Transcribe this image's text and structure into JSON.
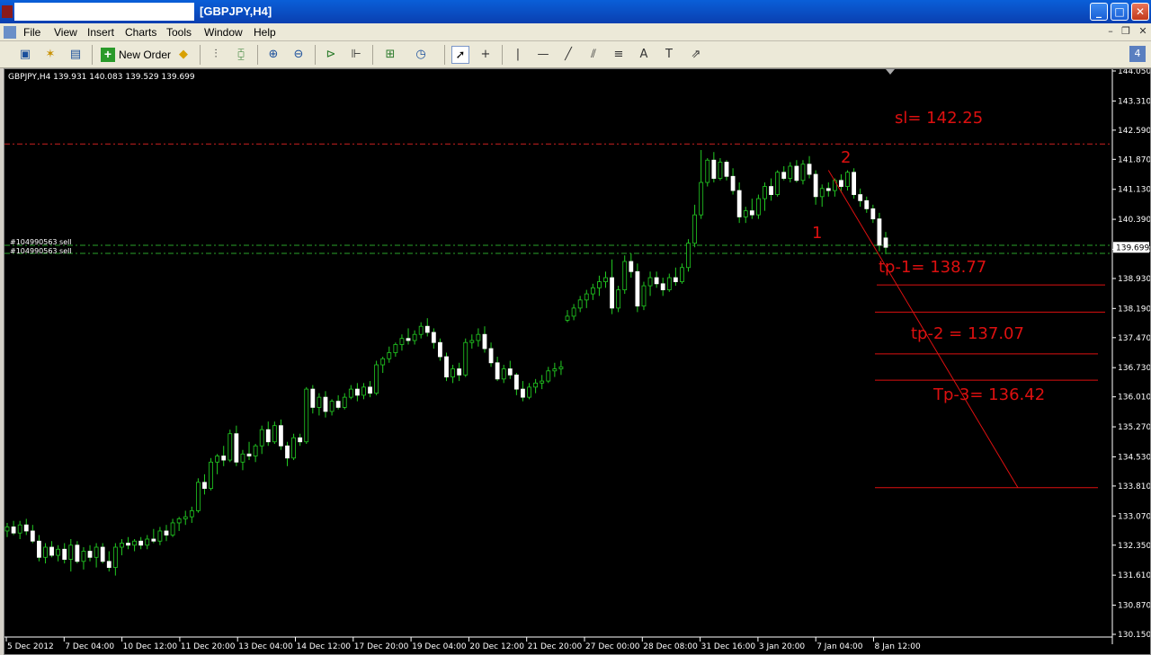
{
  "window": {
    "title": "[GBPJPY,H4]"
  },
  "menu": [
    "File",
    "View",
    "Insert",
    "Charts",
    "Tools",
    "Window",
    "Help"
  ],
  "toolbar": {
    "new_order_label": "New Order",
    "badge": "4"
  },
  "chart_data": {
    "type": "candlestick",
    "symbol_header": "GBPJPY,H4  139.931 140.083 139.529 139.699",
    "current_price": "139.699",
    "price_ticks": [
      "144.050",
      "143.310",
      "142.590",
      "141.870",
      "141.130",
      "140.390",
      "139.650",
      "138.930",
      "138.190",
      "137.470",
      "136.730",
      "136.010",
      "135.270",
      "134.530",
      "133.810",
      "133.070",
      "132.350",
      "131.610",
      "130.870",
      "130.150"
    ],
    "time_ticks": [
      "5 Dec 2012",
      "7 Dec 04:00",
      "10 Dec 12:00",
      "11 Dec 20:00",
      "13 Dec 04:00",
      "14 Dec 12:00",
      "17 Dec 20:00",
      "19 Dec 04:00",
      "20 Dec 12:00",
      "21 Dec 20:00",
      "27 Dec 00:00",
      "28 Dec 08:00",
      "31 Dec 16:00",
      "3 Jan 20:00",
      "7 Jan 04:00",
      "8 Jan 12:00"
    ],
    "ylim": [
      130.15,
      144.05
    ],
    "order_labels": [
      "#104990563 sell",
      "#104990563 sell"
    ],
    "annotations": {
      "sl": "sl= 142.25",
      "tp1": "tp-1= 138.77",
      "tp2": "tp-2 = 137.07",
      "tp3": "Tp-3= 136.42",
      "wave1": "1",
      "wave2": "2"
    },
    "levels": {
      "sl": 142.25,
      "order_entry_1": 139.75,
      "order_entry_2": 139.55,
      "tp1_line": 138.77,
      "tp1b_line": 138.1,
      "tp2_line": 137.07,
      "tp2b_line": 136.42,
      "tp3_line": 133.77
    },
    "trend_line": {
      "from_price": 141.6,
      "to_price": 133.77
    },
    "candles": [
      [
        132.7,
        132.9,
        132.55,
        132.8
      ],
      [
        132.8,
        132.95,
        132.6,
        132.65
      ],
      [
        132.65,
        132.95,
        132.5,
        132.85
      ],
      [
        132.85,
        133.0,
        132.6,
        132.7
      ],
      [
        132.7,
        132.85,
        132.4,
        132.45
      ],
      [
        132.45,
        132.6,
        131.95,
        132.05
      ],
      [
        132.05,
        132.4,
        131.9,
        132.3
      ],
      [
        132.3,
        132.45,
        132.05,
        132.1
      ],
      [
        132.1,
        132.35,
        131.95,
        132.25
      ],
      [
        132.25,
        132.4,
        131.9,
        132.0
      ],
      [
        132.0,
        132.5,
        131.7,
        132.35
      ],
      [
        132.35,
        132.45,
        131.9,
        131.95
      ],
      [
        131.95,
        132.3,
        131.75,
        132.2
      ],
      [
        132.2,
        132.35,
        131.95,
        132.05
      ],
      [
        132.05,
        132.4,
        131.8,
        132.3
      ],
      [
        132.3,
        132.4,
        131.9,
        131.95
      ],
      [
        131.95,
        132.2,
        131.7,
        131.8
      ],
      [
        131.8,
        132.4,
        131.6,
        132.3
      ],
      [
        132.3,
        132.5,
        132.1,
        132.4
      ],
      [
        132.4,
        132.55,
        132.25,
        132.35
      ],
      [
        132.35,
        132.5,
        132.2,
        132.45
      ],
      [
        132.45,
        132.55,
        132.25,
        132.35
      ],
      [
        132.35,
        132.6,
        132.25,
        132.5
      ],
      [
        132.5,
        132.75,
        132.4,
        132.45
      ],
      [
        132.45,
        132.8,
        132.35,
        132.7
      ],
      [
        132.7,
        132.85,
        132.45,
        132.6
      ],
      [
        132.6,
        133.0,
        132.55,
        132.9
      ],
      [
        132.9,
        133.05,
        132.7,
        133.0
      ],
      [
        133.0,
        133.2,
        132.85,
        133.05
      ],
      [
        133.05,
        133.3,
        132.9,
        133.2
      ],
      [
        133.2,
        134.0,
        133.15,
        133.9
      ],
      [
        133.9,
        134.1,
        133.6,
        133.75
      ],
      [
        133.75,
        134.5,
        133.7,
        134.4
      ],
      [
        134.4,
        134.6,
        134.1,
        134.55
      ],
      [
        134.55,
        134.8,
        134.3,
        134.45
      ],
      [
        134.45,
        135.2,
        134.4,
        135.1
      ],
      [
        135.1,
        135.3,
        134.3,
        134.4
      ],
      [
        134.4,
        134.7,
        134.2,
        134.6
      ],
      [
        134.6,
        134.9,
        134.45,
        134.55
      ],
      [
        134.55,
        134.85,
        134.4,
        134.8
      ],
      [
        134.8,
        135.3,
        134.6,
        135.2
      ],
      [
        135.2,
        135.4,
        134.8,
        134.9
      ],
      [
        134.9,
        135.4,
        134.85,
        135.3
      ],
      [
        135.3,
        135.45,
        134.7,
        134.8
      ],
      [
        134.8,
        134.9,
        134.3,
        134.5
      ],
      [
        134.5,
        135.1,
        134.45,
        135.0
      ],
      [
        135.0,
        135.1,
        134.8,
        134.9
      ],
      [
        134.9,
        136.25,
        134.85,
        136.2
      ],
      [
        136.2,
        136.3,
        135.6,
        135.75
      ],
      [
        135.75,
        136.1,
        135.55,
        136.0
      ],
      [
        136.0,
        136.15,
        135.5,
        135.65
      ],
      [
        135.65,
        135.95,
        135.55,
        135.9
      ],
      [
        135.9,
        136.05,
        135.7,
        135.75
      ],
      [
        135.75,
        136.1,
        135.7,
        136.0
      ],
      [
        136.0,
        136.3,
        135.95,
        136.2
      ],
      [
        136.2,
        136.35,
        135.9,
        136.05
      ],
      [
        136.05,
        136.35,
        135.95,
        136.25
      ],
      [
        136.25,
        136.4,
        136.0,
        136.1
      ],
      [
        136.1,
        136.9,
        136.05,
        136.8
      ],
      [
        136.8,
        137.0,
        136.6,
        136.95
      ],
      [
        136.95,
        137.25,
        136.85,
        137.1
      ],
      [
        137.1,
        137.35,
        137.0,
        137.3
      ],
      [
        137.3,
        137.55,
        137.15,
        137.45
      ],
      [
        137.45,
        137.7,
        137.3,
        137.4
      ],
      [
        137.4,
        137.65,
        137.3,
        137.55
      ],
      [
        137.55,
        137.85,
        137.45,
        137.75
      ],
      [
        137.75,
        137.95,
        137.5,
        137.6
      ],
      [
        137.6,
        137.7,
        137.2,
        137.35
      ],
      [
        137.35,
        137.45,
        136.9,
        137.0
      ],
      [
        137.0,
        137.1,
        136.4,
        136.5
      ],
      [
        136.5,
        136.8,
        136.35,
        136.7
      ],
      [
        136.7,
        136.85,
        136.4,
        136.55
      ],
      [
        136.55,
        137.45,
        136.5,
        137.35
      ],
      [
        137.35,
        137.55,
        137.2,
        137.4
      ],
      [
        137.4,
        137.7,
        137.25,
        137.55
      ],
      [
        137.55,
        137.75,
        137.1,
        137.2
      ],
      [
        137.2,
        137.35,
        136.75,
        136.85
      ],
      [
        136.85,
        137.0,
        136.4,
        136.45
      ],
      [
        136.45,
        136.8,
        136.35,
        136.7
      ],
      [
        136.7,
        136.9,
        136.45,
        136.55
      ],
      [
        136.55,
        136.6,
        136.05,
        136.2
      ],
      [
        136.2,
        136.4,
        135.9,
        136.0
      ],
      [
        136.0,
        136.35,
        135.95,
        136.25
      ],
      [
        136.25,
        136.45,
        136.1,
        136.35
      ],
      [
        136.35,
        136.55,
        136.2,
        136.4
      ],
      [
        136.4,
        136.75,
        136.35,
        136.65
      ],
      [
        136.65,
        136.85,
        136.5,
        136.7
      ],
      [
        136.7,
        136.9,
        136.55,
        136.75
      ],
      [
        137.9,
        138.15,
        137.85,
        138.0
      ],
      [
        138.0,
        138.3,
        137.9,
        138.2
      ],
      [
        138.2,
        138.5,
        138.1,
        138.4
      ],
      [
        138.4,
        138.65,
        138.2,
        138.55
      ],
      [
        138.55,
        138.8,
        138.4,
        138.7
      ],
      [
        138.7,
        139.0,
        138.5,
        138.85
      ],
      [
        138.85,
        139.1,
        138.7,
        138.95
      ],
      [
        138.95,
        139.4,
        138.05,
        138.2
      ],
      [
        138.2,
        138.75,
        138.1,
        138.65
      ],
      [
        138.65,
        139.5,
        138.55,
        139.35
      ],
      [
        139.35,
        139.55,
        138.95,
        139.1
      ],
      [
        139.1,
        139.3,
        138.1,
        138.25
      ],
      [
        138.25,
        138.85,
        138.15,
        138.75
      ],
      [
        138.75,
        139.1,
        138.5,
        138.95
      ],
      [
        138.95,
        139.1,
        138.7,
        138.8
      ],
      [
        138.8,
        138.95,
        138.5,
        138.65
      ],
      [
        138.65,
        139.05,
        138.6,
        138.95
      ],
      [
        138.95,
        139.2,
        138.75,
        138.85
      ],
      [
        138.85,
        139.3,
        138.8,
        139.2
      ],
      [
        139.2,
        139.9,
        139.1,
        139.8
      ],
      [
        139.8,
        140.75,
        139.7,
        140.5
      ],
      [
        140.5,
        142.1,
        140.4,
        141.3
      ],
      [
        141.3,
        141.9,
        141.2,
        141.85
      ],
      [
        141.85,
        142.05,
        141.3,
        141.4
      ],
      [
        141.4,
        141.9,
        141.35,
        141.8
      ],
      [
        141.8,
        141.85,
        141.35,
        141.45
      ],
      [
        141.45,
        141.65,
        141.0,
        141.1
      ],
      [
        141.1,
        141.3,
        140.3,
        140.45
      ],
      [
        140.45,
        140.7,
        140.3,
        140.6
      ],
      [
        140.6,
        140.9,
        140.4,
        140.5
      ],
      [
        140.5,
        141.0,
        140.4,
        140.9
      ],
      [
        140.9,
        141.3,
        140.6,
        141.2
      ],
      [
        141.2,
        141.4,
        140.85,
        141.0
      ],
      [
        141.0,
        141.6,
        140.95,
        141.55
      ],
      [
        141.55,
        141.7,
        141.35,
        141.4
      ],
      [
        141.4,
        141.8,
        141.3,
        141.7
      ],
      [
        141.7,
        141.85,
        141.3,
        141.35
      ],
      [
        141.35,
        141.85,
        141.25,
        141.75
      ],
      [
        141.75,
        141.95,
        141.4,
        141.5
      ],
      [
        141.5,
        141.6,
        140.75,
        140.95
      ],
      [
        140.95,
        141.25,
        140.7,
        141.15
      ],
      [
        141.15,
        141.3,
        140.95,
        141.1
      ],
      [
        141.1,
        141.4,
        140.95,
        141.35
      ],
      [
        141.35,
        141.5,
        141.05,
        141.2
      ],
      [
        141.2,
        141.6,
        141.1,
        141.55
      ],
      [
        141.55,
        141.65,
        140.9,
        141.0
      ],
      [
        141.0,
        141.15,
        140.7,
        140.85
      ],
      [
        140.85,
        140.95,
        140.55,
        140.65
      ],
      [
        140.65,
        140.75,
        140.3,
        140.4
      ],
      [
        140.4,
        140.55,
        139.6,
        139.75
      ],
      [
        139.93,
        140.08,
        139.53,
        139.7
      ]
    ]
  }
}
